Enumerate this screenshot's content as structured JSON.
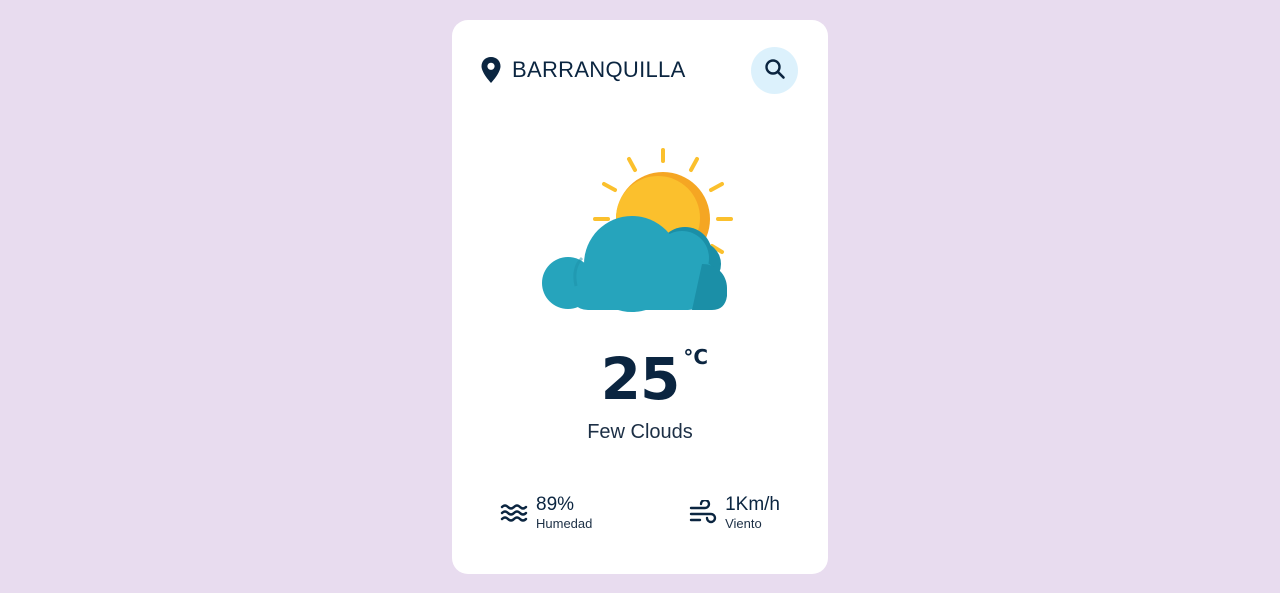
{
  "location": {
    "icon": "map-pin-icon",
    "city": "BARRANQUILLA"
  },
  "search": {
    "icon": "search-icon",
    "accent_bg": "#dcf1fc"
  },
  "weather": {
    "icon": "sun-behind-cloud-icon",
    "temperature": "25",
    "unit": "°C",
    "description": "Few Clouds"
  },
  "details": {
    "humidity": {
      "icon": "waves-icon",
      "value": "89%",
      "label": "Humedad"
    },
    "wind": {
      "icon": "wind-icon",
      "value": "1Km/h",
      "label": "Viento"
    }
  },
  "colors": {
    "background": "#e8dcef",
    "card": "#ffffff",
    "text_primary": "#0b2540",
    "sun": "#fbc02d",
    "cloud": "#26a4bc"
  }
}
